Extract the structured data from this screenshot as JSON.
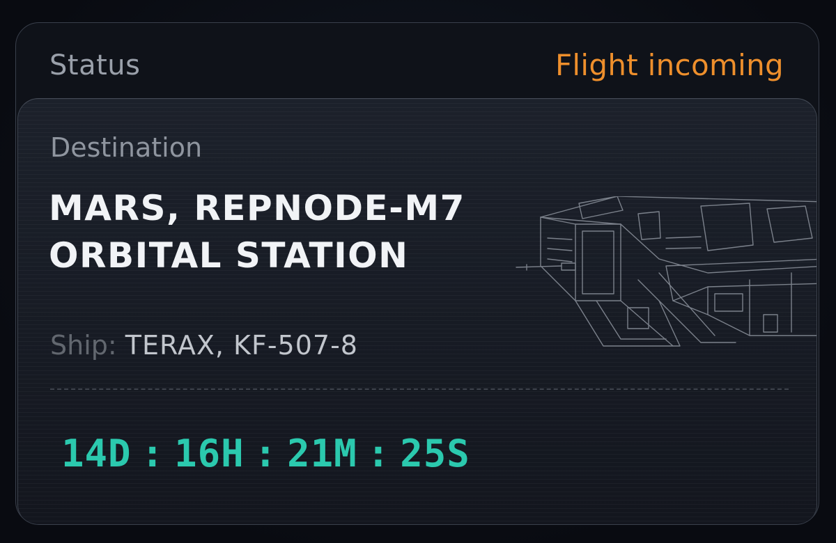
{
  "status": {
    "label": "Status",
    "value": "Flight incoming",
    "value_color": "#ee8f2c"
  },
  "destination": {
    "label": "Destination",
    "line1": "MARS, REPNODE-M7",
    "line2": "ORBITAL STATION"
  },
  "ship": {
    "label": "Ship:",
    "value": "TERAX, KF-507-8"
  },
  "countdown": {
    "days": "14D",
    "hours": "16H",
    "minutes": "21M",
    "seconds": "25S",
    "separator": ":",
    "color": "#2bc9ae"
  },
  "illustration": {
    "icon": "spaceship-wireframe-icon"
  }
}
